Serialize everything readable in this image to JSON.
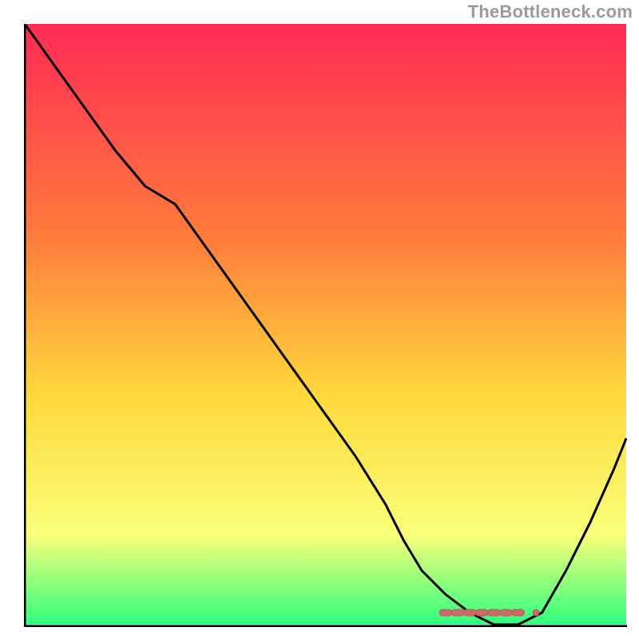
{
  "attribution": "TheBottleneck.com",
  "colors": {
    "gradient_top": "#ff2b55",
    "gradient_mid1": "#ff7a3c",
    "gradient_mid2": "#ffd93b",
    "gradient_mid3": "#faff7a",
    "gradient_bottom": "#2fff7f",
    "axis": "#000000",
    "curve": "#000000",
    "marker_fill": "#cc6a66",
    "marker_stroke": "#b95a56"
  },
  "chart_data": {
    "type": "line",
    "title": "",
    "xlabel": "",
    "ylabel": "",
    "xlim": [
      0,
      100
    ],
    "ylim": [
      0,
      100
    ],
    "grid": false,
    "legend": false,
    "series": [
      {
        "name": "bottleneck-curve",
        "x": [
          0,
          5,
          10,
          15,
          20,
          25,
          30,
          35,
          40,
          45,
          50,
          55,
          60,
          63,
          66,
          70,
          74,
          78,
          82,
          86,
          90,
          94,
          98,
          100
        ],
        "y": [
          100,
          93,
          86,
          79,
          73,
          70,
          63,
          56,
          49,
          42,
          35,
          28,
          20,
          14,
          9,
          5,
          2,
          0,
          0,
          2,
          9,
          17,
          26,
          31
        ]
      }
    ],
    "markers": {
      "name": "optimal-range",
      "x": [
        70,
        72,
        74,
        76,
        78,
        80,
        82
      ],
      "y": [
        2,
        2,
        2,
        2,
        2,
        2,
        2
      ]
    }
  }
}
